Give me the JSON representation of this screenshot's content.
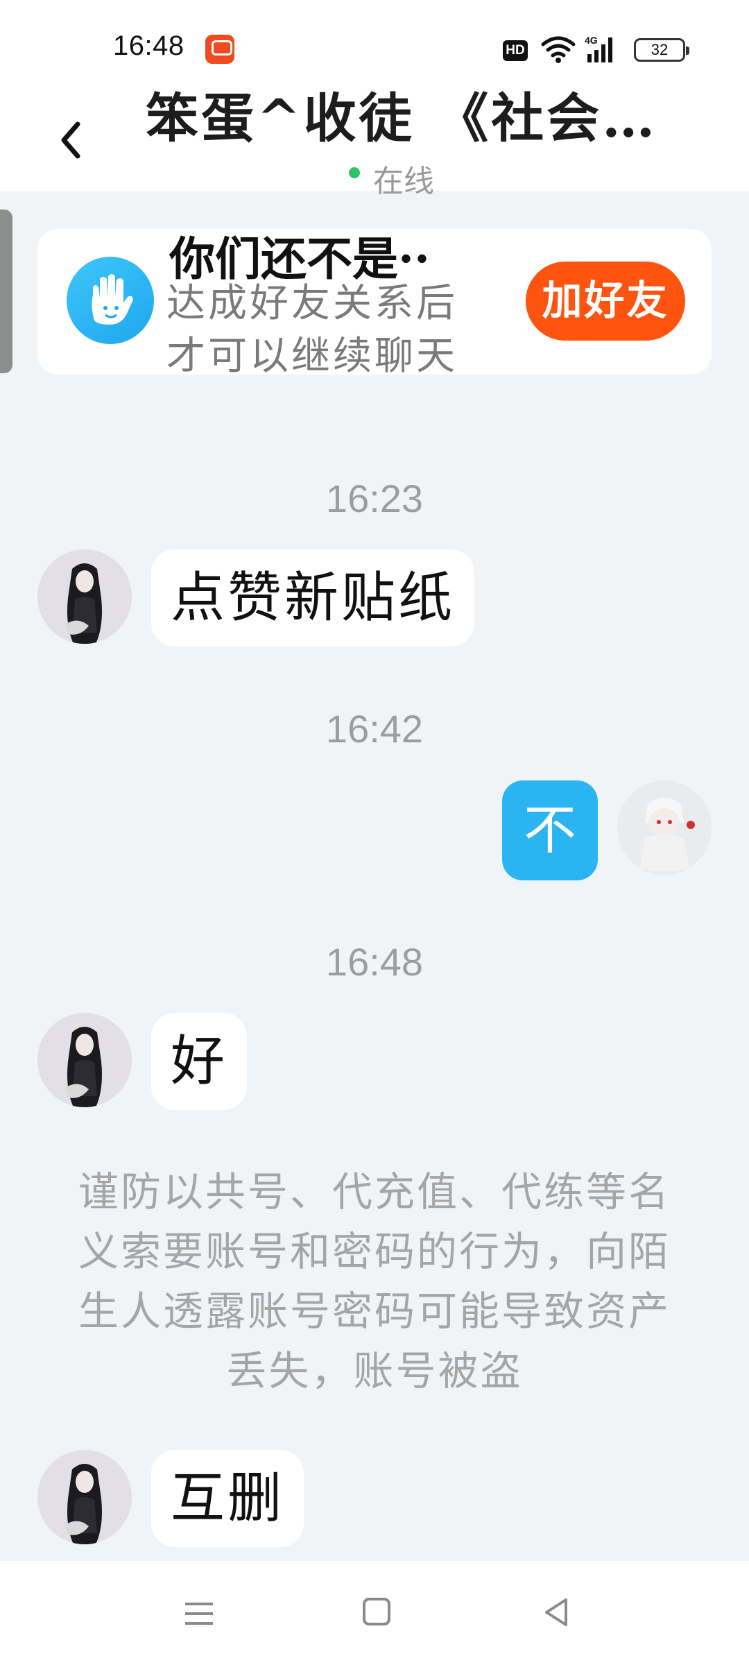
{
  "status_bar": {
    "time": "16:48",
    "hd": "HD",
    "network": "4G",
    "battery": "32"
  },
  "header": {
    "title": "笨蛋^收徒 《社会…",
    "status": "在线"
  },
  "friend_card": {
    "title": "你们还不是··",
    "subtitle": "达成好友关系后才可以继续聊天",
    "button": "加好友"
  },
  "messages": [
    {
      "timestamp": "16:23",
      "sender": "other",
      "text": "点赞新贴纸"
    },
    {
      "timestamp": "16:42",
      "sender": "me",
      "text": "不"
    },
    {
      "timestamp": "16:48",
      "sender": "other",
      "text": "好"
    },
    {
      "sender": "other",
      "text": "互删"
    }
  ],
  "notice": "谨防以共号、代充值、代练等名义索要账号和密码的行为，向陌生人透露账号密码可能导致资产丢失，账号被盗",
  "colors": {
    "background": "#f1f4f7",
    "accent_blue": "#2ab5f2",
    "add_friend_orange": "#ff5410",
    "online_green": "#2cc466"
  },
  "icons": [
    "back-arrow-icon",
    "wave-hand-icon",
    "menu-icon",
    "home-icon",
    "nav-back-icon",
    "wifi-icon",
    "signal-icon",
    "battery-icon"
  ]
}
